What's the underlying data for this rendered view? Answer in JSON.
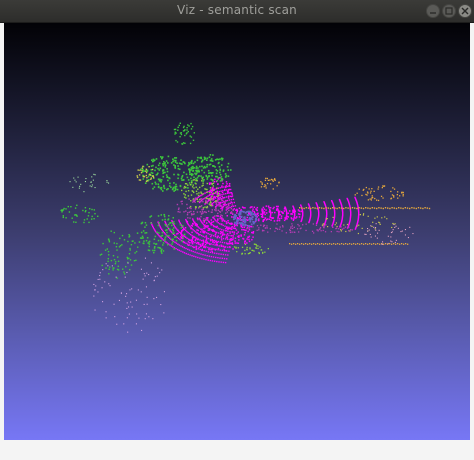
{
  "window": {
    "title": "Viz - semantic scan"
  },
  "icons": {
    "minimize": "minimize-icon",
    "maximize": "maximize-icon",
    "close": "close-icon"
  },
  "colors": {
    "background_top": "#020206",
    "background_bottom": "#7777f5",
    "road": "#ff00ff",
    "vegetation": "#3cc83c",
    "terrain": "#8ad33a",
    "sidewalk": "#b43cb4",
    "fence": "#e6a83c",
    "vehicle": "#6464c8",
    "pole": "#c8c84b"
  }
}
